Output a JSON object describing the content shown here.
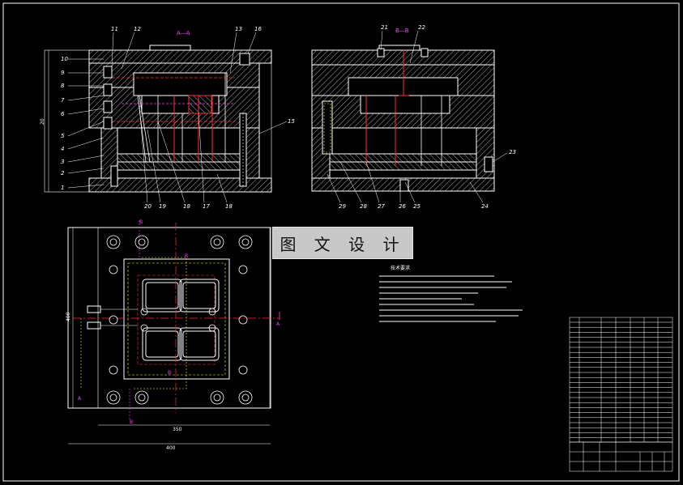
{
  "drawing": {
    "section_aa_label": "A—A",
    "section_bb_label": "B—B",
    "watermark_text": "图 文 设 计",
    "notes_title": "技术要求",
    "left_callouts": [
      "10",
      "9",
      "8",
      "7",
      "6",
      "5",
      "4",
      "3",
      "2",
      "1"
    ],
    "top_callouts_left": [
      "11",
      "12",
      "13",
      "16"
    ],
    "bottom_callouts_left": [
      "20",
      "19",
      "18",
      "17",
      "18"
    ],
    "side_callout_15": "15",
    "top_callouts_right": [
      "21",
      "22"
    ],
    "side_callout_23": "23",
    "bottom_callouts_right": [
      "29",
      "28",
      "27",
      "26",
      "25",
      "24"
    ],
    "dim_height": "20",
    "dim_inner_width": "350",
    "dim_outer_width": "400",
    "dim_plan_height": "400",
    "section_marks": [
      "A",
      "A",
      "B",
      "B",
      "B",
      "B"
    ]
  },
  "colors": {
    "background": "#000000",
    "line": "#ffffff",
    "hatch": "#cfcfcf",
    "center": "#ff3030",
    "hidden": "#ffff00",
    "accent": "#ff40ff",
    "dim": "#ffffff"
  }
}
